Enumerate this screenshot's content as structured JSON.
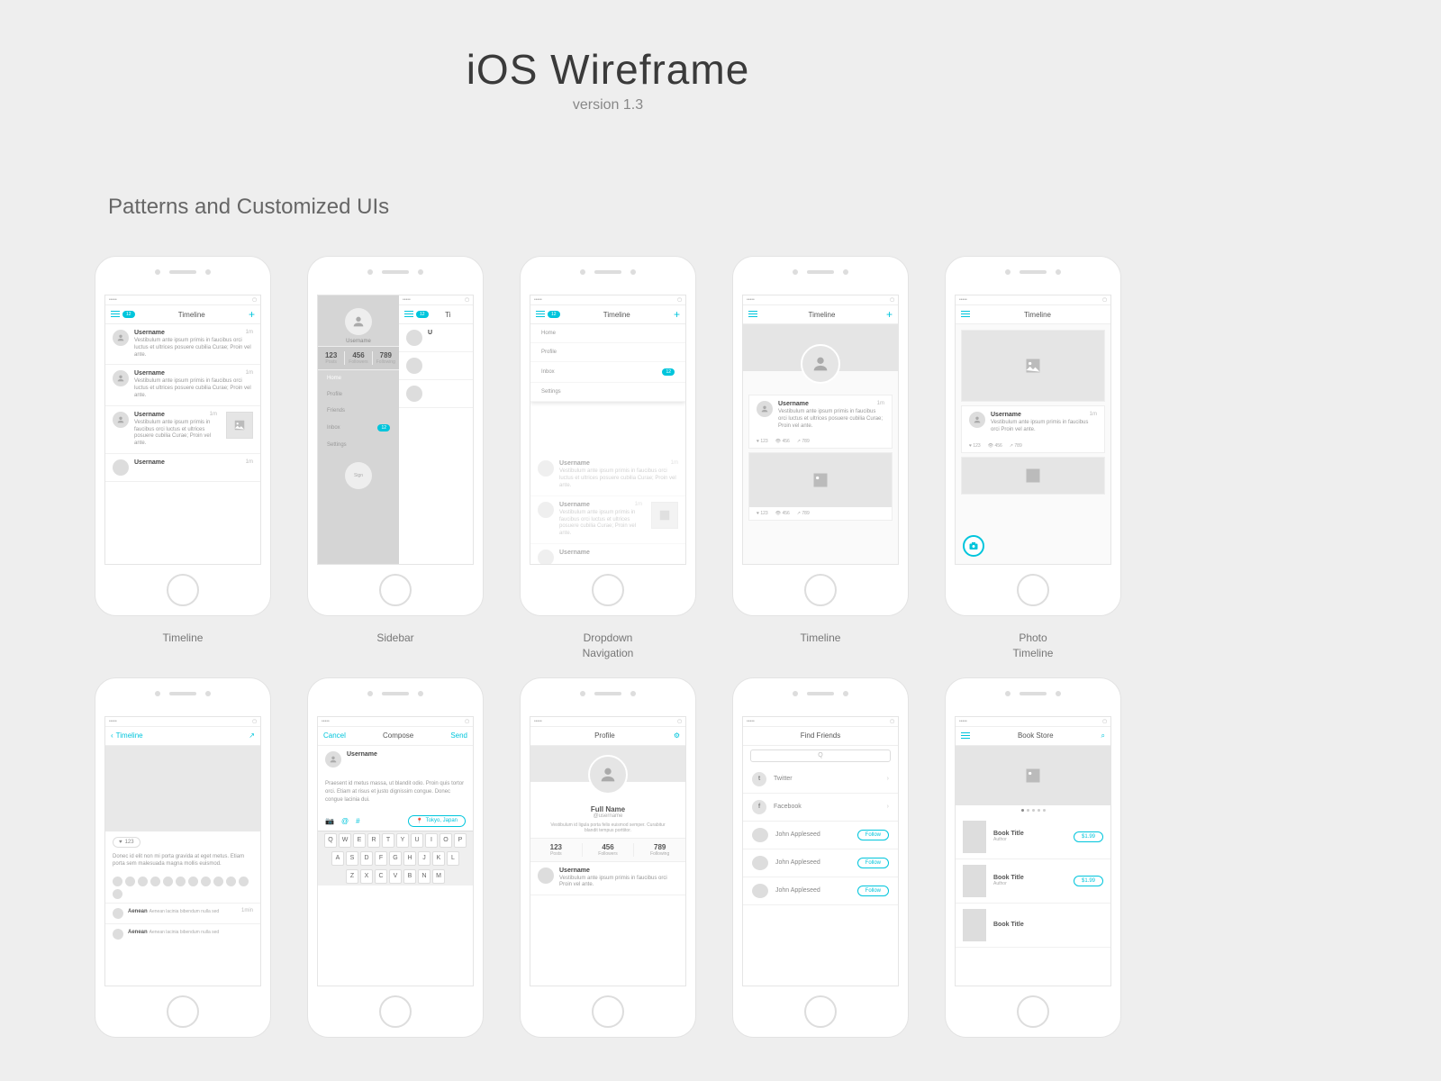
{
  "header": {
    "title": "iOS Wireframe",
    "subtitle": "version 1.3"
  },
  "section_title": "Patterns and Customized UIs",
  "captions": {
    "timeline": "Timeline",
    "sidebar": "Sidebar",
    "dropdown": "Dropdown\nNavigation",
    "timeline2": "Timeline",
    "photo_timeline": "Photo\nTimeline"
  },
  "nav": {
    "timeline": "Timeline",
    "compose": "Compose",
    "profile": "Profile",
    "find_friends": "Find Friends",
    "book_store": "Book Store",
    "cancel": "Cancel",
    "send": "Send",
    "back": "Timeline",
    "badge": "12"
  },
  "post": {
    "username": "Username",
    "time": "1m",
    "text": "Vestibulum ante ipsum primis in faucibus orci luctus et ultrices posuere cubilia Curae; Proin vel ante.",
    "text_short": "Vestibulum ante ipsum primis in faucibus orci Proin vel ante."
  },
  "stats": {
    "posts_n": "123",
    "posts_l": "Posts",
    "followers_n": "456",
    "followers_l": "Followers",
    "following_n": "789",
    "following_l": "Following"
  },
  "meta": {
    "likes": "123",
    "views": "456",
    "shares": "789"
  },
  "sidebar_menu": [
    "Home",
    "Profile",
    "Friends",
    "Inbox",
    "Settings"
  ],
  "sidebar_badge": "12",
  "sidebar_signout": "Sign",
  "dropdown_menu": [
    "Home",
    "Profile",
    "Inbox",
    "Settings"
  ],
  "dropdown_badge": "12",
  "detail": {
    "likes": "123",
    "body": "Donec id elit non mi porta gravida at eget metus. Etiam porta sem malesuada magna mollis euismod.",
    "reply1_user": "Aenean",
    "reply1_text": "Aenean lacinia bibendum nulla sed",
    "reply1_time": "1min",
    "reply2_user": "Aenean",
    "reply2_text": "Aenean lacinia bibendum nulla sed"
  },
  "compose": {
    "text": "Praesent id metus massa, ut blandit odio. Proin quis tortor orci. Etiam at risus et justo dignissim congue. Donec congue lacinia dui.",
    "location": "Tokyo, Japan",
    "row1": [
      "Q",
      "W",
      "E",
      "R",
      "T",
      "Y",
      "U",
      "I",
      "O",
      "P"
    ],
    "row2": [
      "A",
      "S",
      "D",
      "F",
      "G",
      "H",
      "J",
      "K",
      "L"
    ],
    "row3": [
      "Z",
      "X",
      "C",
      "V",
      "B",
      "N",
      "M"
    ]
  },
  "profile": {
    "fullname": "Full Name",
    "handle": "@username",
    "bio": "Vestibulum id ligula porta felis euismod semper. Curabitur blandit tempus porttitor."
  },
  "friends": {
    "twitter": "Twitter",
    "facebook": "Facebook",
    "name": "John Appleseed",
    "follow": "Follow",
    "search_ph": "Q"
  },
  "book": {
    "title": "Book Title",
    "author": "Author",
    "price": "$1.99"
  }
}
